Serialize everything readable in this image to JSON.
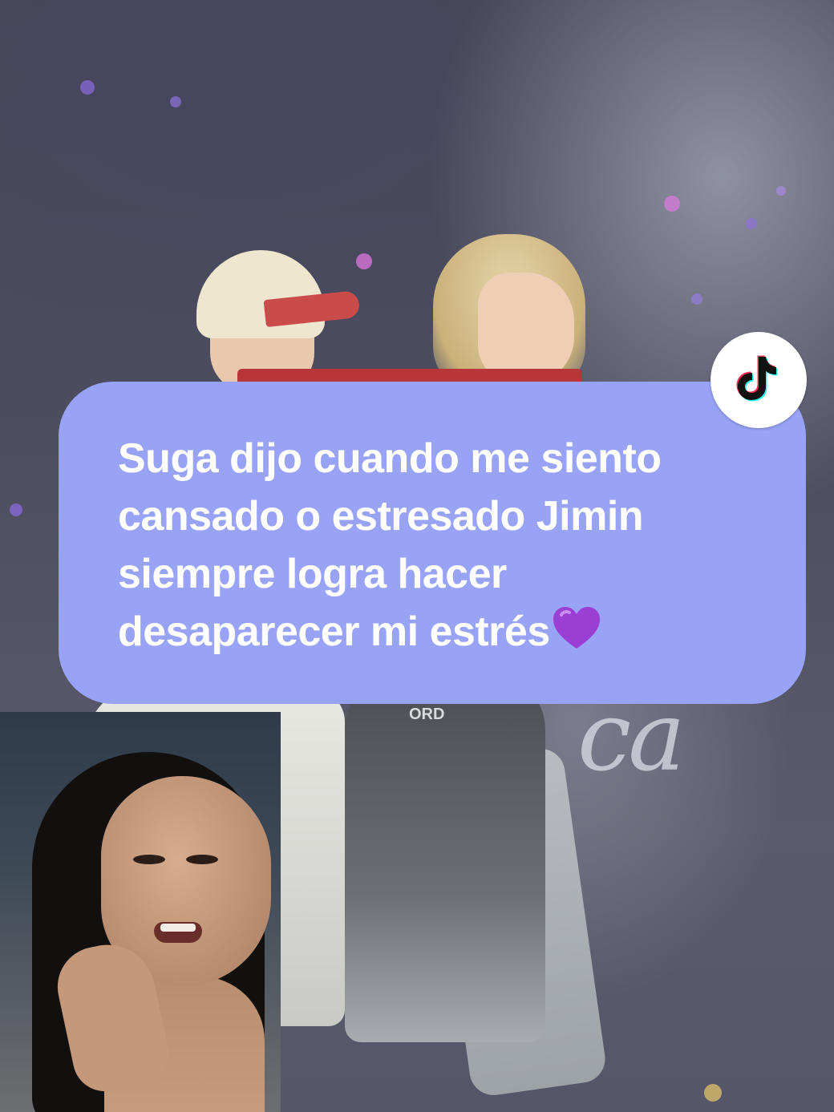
{
  "caption": {
    "lines": [
      "Suga dijo cuando me siento",
      "cansado o estresado Jimin",
      "siempre logra hacer",
      "desaparecer mi estrés"
    ],
    "emoji": "purple-heart",
    "background_color": "#98a3f6",
    "text_color": "#ffffff"
  },
  "badge": {
    "icon": "tiktok-logo-icon"
  },
  "background": {
    "script_text": "ca",
    "shirt_text": "ORD"
  }
}
